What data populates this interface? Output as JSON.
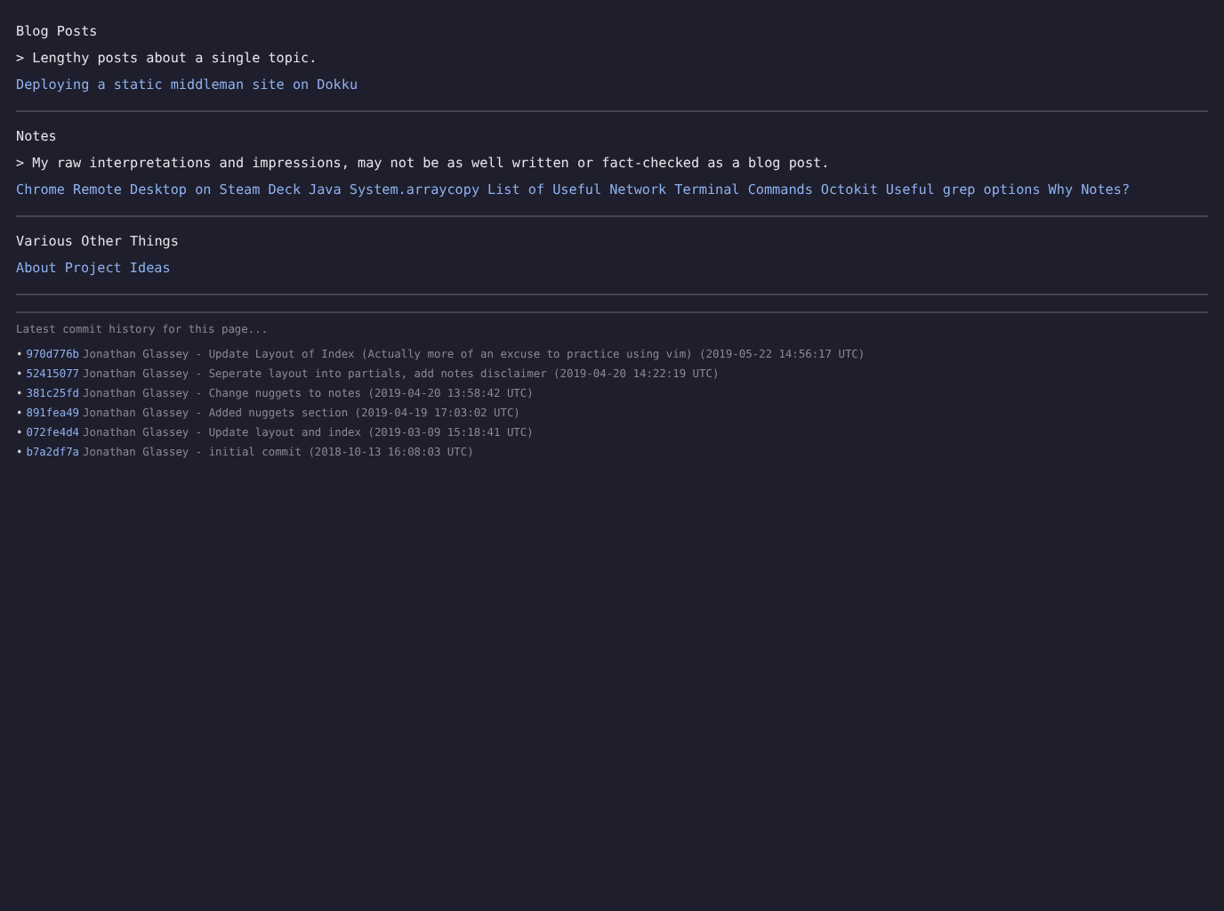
{
  "sections": [
    {
      "title": "Blog Posts",
      "description": "> Lengthy posts about a single topic.",
      "links": [
        "Deploying a static middleman site on Dokku"
      ]
    },
    {
      "title": "Notes",
      "description": "> My raw interpretations and impressions, may not be as well written or fact-checked as a blog post.",
      "links": [
        "Chrome Remote Desktop on Steam Deck",
        "Java System.arraycopy",
        "List of Useful Network Terminal Commands",
        "Octokit",
        "Useful grep options",
        "Why Notes?"
      ]
    },
    {
      "title": "Various Other Things",
      "links": [
        "About",
        "Project Ideas"
      ]
    }
  ],
  "commit_history": {
    "intro": "Latest commit history for this page...",
    "commits": [
      {
        "bullet": "•",
        "sha": "970d776b",
        "message": "Jonathan Glassey - Update Layout of Index (Actually more of an excuse to practice using vim) (2019-05-22 14:56:17 UTC)"
      },
      {
        "bullet": "•",
        "sha": "52415077",
        "message": "Jonathan Glassey - Seperate layout into partials, add notes disclaimer (2019-04-20 14:22:19 UTC)"
      },
      {
        "bullet": "•",
        "sha": "381c25fd",
        "message": "Jonathan Glassey - Change nuggets to notes (2019-04-20 13:58:42 UTC)"
      },
      {
        "bullet": "•",
        "sha": "891fea49",
        "message": "Jonathan Glassey - Added nuggets section (2019-04-19 17:03:02 UTC)"
      },
      {
        "bullet": "•",
        "sha": "072fe4d4",
        "message": "Jonathan Glassey - Update layout and index (2019-03-09 15:18:41 UTC)"
      },
      {
        "bullet": "•",
        "sha": "b7a2df7a",
        "message": "Jonathan Glassey - initial commit (2018-10-13 16:08:03 UTC)"
      }
    ]
  }
}
